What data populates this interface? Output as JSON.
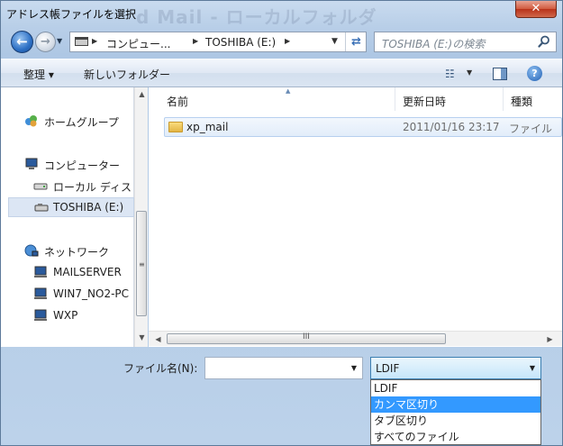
{
  "window": {
    "title": "アドレス帳ファイルを選択",
    "background_title": "d Mail - ローカルフォルダ"
  },
  "nav": {
    "address_crumbs": [
      "コンピュー...",
      "TOSHIBA (E:)"
    ],
    "search_placeholder": "TOSHIBA (E:)の検索"
  },
  "toolbar": {
    "organize": "整理 ▾",
    "new_folder": "新しいフォルダー"
  },
  "sidebar": {
    "items": [
      {
        "label": "ホームグループ",
        "icon": "homegroup-icon"
      },
      {
        "label": "コンピューター",
        "icon": "computer-icon"
      },
      {
        "label": "ローカル ディス",
        "icon": "drive-icon"
      },
      {
        "label": "TOSHIBA (E:)",
        "icon": "usb-drive-icon"
      },
      {
        "label": "ネットワーク",
        "icon": "network-icon"
      },
      {
        "label": "MAILSERVER",
        "icon": "network-computer-icon"
      },
      {
        "label": "WIN7_NO2-PC",
        "icon": "network-computer-icon"
      },
      {
        "label": "WXP",
        "icon": "network-computer-icon"
      }
    ],
    "selected_index": 3
  },
  "files": {
    "columns": [
      "名前",
      "更新日時",
      "種類"
    ],
    "rows": [
      {
        "name": "xp_mail",
        "modified": "2011/01/16 23:17",
        "type": "ファイル"
      }
    ]
  },
  "bottom": {
    "filename_label": "ファイル名(N):",
    "filename_value": "",
    "filetype_selected": "LDIF",
    "filetype_options": [
      "LDIF",
      "カンマ区切り",
      "タブ区切り",
      "すべてのファイル"
    ],
    "highlighted_option_index": 1
  },
  "colors": {
    "highlight": "#3399ff",
    "selection_bg": "#dce6f4"
  }
}
